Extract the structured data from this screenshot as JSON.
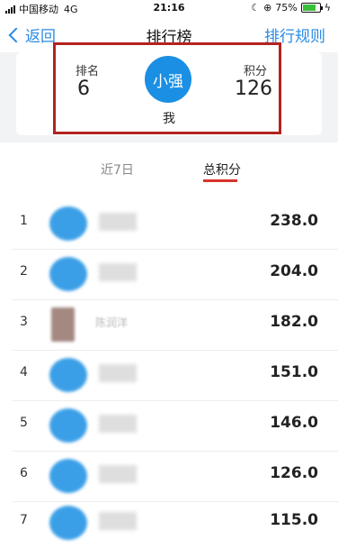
{
  "status_bar": {
    "carrier": "中国移动",
    "network": "4G",
    "time": "21:16",
    "battery": "75%",
    "battery_level": 0.75
  },
  "nav": {
    "back_label": "返回",
    "title": "排行榜",
    "rules_label": "排行规则"
  },
  "me": {
    "rank_label": "排名",
    "rank_value": "6",
    "avatar_text": "小强",
    "name_label": "我",
    "score_label": "积分",
    "score_value": "126"
  },
  "tabs": [
    {
      "label": "近7日",
      "active": false
    },
    {
      "label": "总积分",
      "active": true
    }
  ],
  "ranking": [
    {
      "rank": "1",
      "name": "",
      "score": "238.0"
    },
    {
      "rank": "2",
      "name": "",
      "score": "204.0"
    },
    {
      "rank": "3",
      "name": "陈润洋",
      "score": "182.0"
    },
    {
      "rank": "4",
      "name": "",
      "score": "151.0"
    },
    {
      "rank": "5",
      "name": "",
      "score": "146.0"
    },
    {
      "rank": "6",
      "name": "",
      "score": "126.0"
    },
    {
      "rank": "7",
      "name": "",
      "score": "115.0"
    }
  ],
  "colors": {
    "accent": "#2a8ae6",
    "avatar_blue": "#1a8fe3",
    "highlight_box": "#b3231e",
    "tab_underline": "#d9342b"
  }
}
